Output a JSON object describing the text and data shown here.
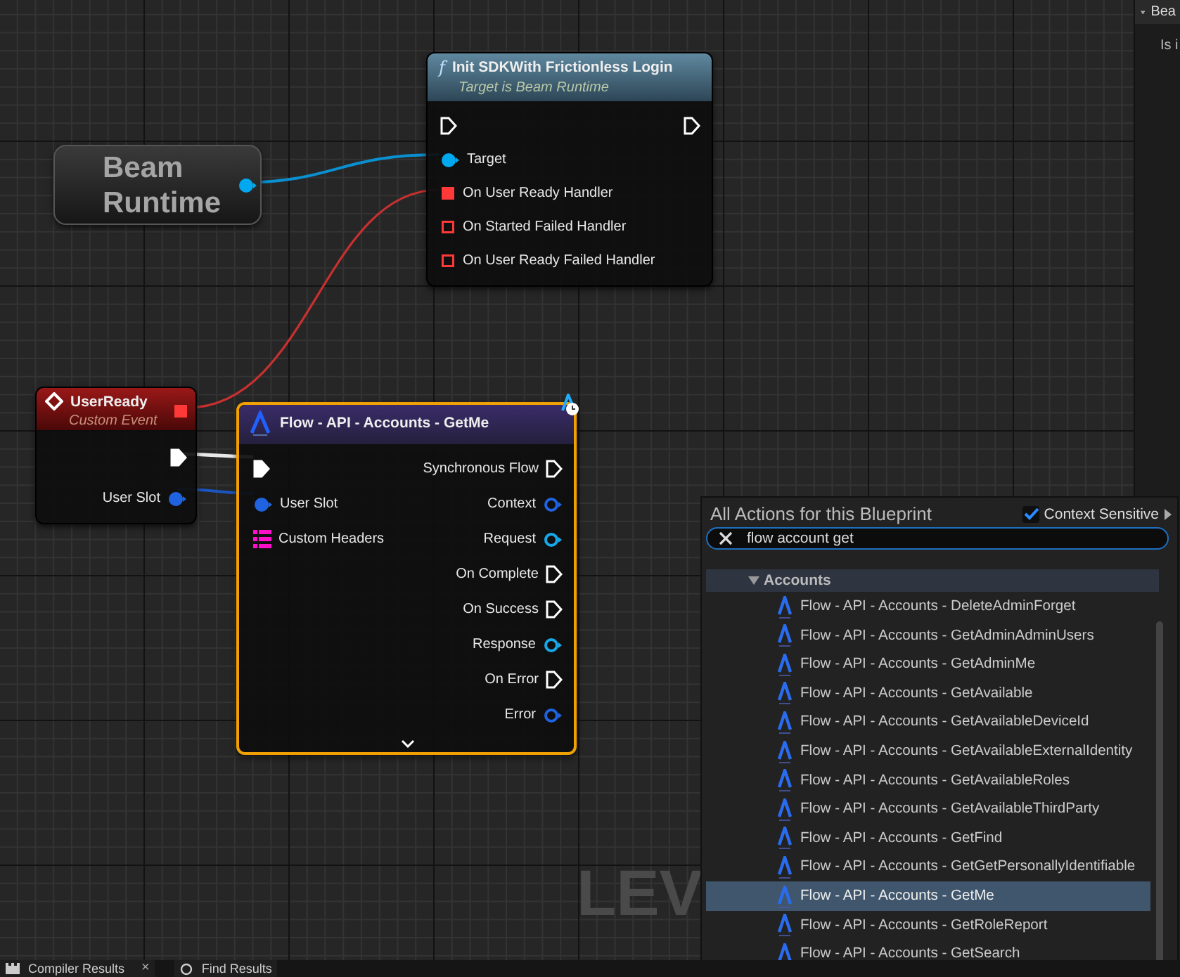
{
  "canvas": {
    "watermark": "LEV"
  },
  "details_panel": {
    "header": "Bea",
    "row": "Is i"
  },
  "nodes": [
    {
      "kind": "variable",
      "title": "Beam Runtime",
      "rows": [
        {
          "out": {
            "kind": "object",
            "connected": true,
            "color": "#00a8f0"
          }
        }
      ]
    },
    {
      "kind": "function",
      "icon_glyph": "f",
      "title": "Init SDKWith Frictionless Login",
      "subtitle": "Target is Beam Runtime",
      "rows": [
        {
          "in": {
            "kind": "exec",
            "connected": false
          },
          "out": {
            "kind": "exec",
            "connected": false
          }
        },
        {
          "in": {
            "kind": "object",
            "label": "Target",
            "connected": true,
            "color": "#00a8f0"
          }
        },
        {
          "in": {
            "kind": "delegate",
            "label": "On User Ready Handler",
            "connected": true,
            "color": "#ff3838"
          }
        },
        {
          "in": {
            "kind": "delegate",
            "label": "On Started Failed Handler",
            "connected": false,
            "color": "#ff3838"
          }
        },
        {
          "in": {
            "kind": "delegate",
            "label": "On User Ready Failed Handler",
            "connected": false,
            "color": "#ff3838"
          }
        }
      ]
    },
    {
      "kind": "event",
      "title": "UserReady",
      "subtitle": "Custom Event",
      "header_pin": {
        "kind": "delegate",
        "connected": true,
        "color": "#ff3838"
      },
      "rows": [
        {
          "out": {
            "kind": "exec",
            "connected": true
          }
        },
        {
          "out": {
            "kind": "object",
            "label": "User Slot",
            "connected": true,
            "color": "#1f63e0"
          }
        }
      ]
    },
    {
      "kind": "async",
      "selected": true,
      "title": "Flow - API - Accounts - GetMe",
      "rows": [
        {
          "in": {
            "kind": "exec",
            "connected": true
          },
          "out": {
            "kind": "exec",
            "label": "Synchronous Flow",
            "connected": false
          }
        },
        {
          "in": {
            "kind": "object",
            "label": "User Slot",
            "connected": true,
            "color": "#1f63e0"
          },
          "out": {
            "kind": "object",
            "label": "Context",
            "connected": false,
            "color": "#1f63e0"
          }
        },
        {
          "in": {
            "kind": "map",
            "label": "Custom Headers",
            "connected": false,
            "color": "#ff10c8"
          },
          "out": {
            "kind": "object",
            "label": "Request",
            "connected": false,
            "color": "#18a8e8"
          }
        },
        {
          "out": {
            "kind": "exec",
            "label": "On Complete",
            "connected": false
          }
        },
        {
          "out": {
            "kind": "exec",
            "label": "On Success",
            "connected": false
          }
        },
        {
          "out": {
            "kind": "object",
            "label": "Response",
            "connected": false,
            "color": "#18a8e8"
          }
        },
        {
          "out": {
            "kind": "exec",
            "label": "On Error",
            "connected": false
          }
        },
        {
          "out": {
            "kind": "object",
            "label": "Error",
            "connected": false,
            "color": "#1f63e0"
          }
        }
      ]
    }
  ],
  "action_menu": {
    "title": "All Actions for this Blueprint",
    "context_sensitive": {
      "label": "Context Sensitive",
      "checked": true
    },
    "search": {
      "value": "flow account get"
    },
    "category": {
      "label": "Accounts",
      "expanded": true
    },
    "items": [
      {
        "label": "Flow - API - Accounts - DeleteAdminForget",
        "selected": false
      },
      {
        "label": "Flow - API - Accounts - GetAdminAdminUsers",
        "selected": false
      },
      {
        "label": "Flow - API - Accounts - GetAdminMe",
        "selected": false
      },
      {
        "label": "Flow - API - Accounts - GetAvailable",
        "selected": false
      },
      {
        "label": "Flow - API - Accounts - GetAvailableDeviceId",
        "selected": false
      },
      {
        "label": "Flow - API - Accounts - GetAvailableExternalIdentity",
        "selected": false
      },
      {
        "label": "Flow - API - Accounts - GetAvailableRoles",
        "selected": false
      },
      {
        "label": "Flow - API - Accounts - GetAvailableThirdParty",
        "selected": false
      },
      {
        "label": "Flow - API - Accounts - GetFind",
        "selected": false
      },
      {
        "label": "Flow - API - Accounts - GetGetPersonallyIdentifiable",
        "selected": false
      },
      {
        "label": "Flow - API - Accounts - GetMe",
        "selected": true
      },
      {
        "label": "Flow - API - Accounts - GetRoleReport",
        "selected": false
      },
      {
        "label": "Flow - API - Accounts - GetSearch",
        "selected": false
      }
    ]
  },
  "bottom_tabs": [
    {
      "label": "Compiler Results",
      "close_glyph": "×",
      "kind": "compiler"
    },
    {
      "label": "Find Results",
      "kind": "find"
    }
  ]
}
